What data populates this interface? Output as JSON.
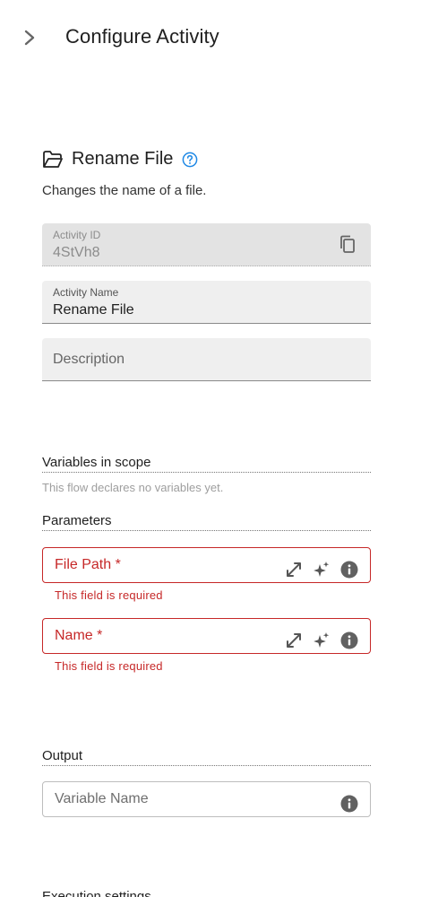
{
  "header": {
    "title": "Configure Activity",
    "toggle_icon": "chevron-right-icon"
  },
  "activity": {
    "icon": "folder-open-icon",
    "title": "Rename File",
    "help_icon": "help-circle-icon",
    "description": "Changes the name of a file."
  },
  "fields": {
    "activity_id": {
      "label": "Activity ID",
      "value": "4StVh8",
      "copy_icon": "copy-icon"
    },
    "activity_name": {
      "label": "Activity Name",
      "value": "Rename File"
    },
    "description": {
      "placeholder": "Description"
    }
  },
  "variables": {
    "title": "Variables in scope",
    "empty_text": "This flow declares no variables yet."
  },
  "parameters": {
    "title": "Parameters",
    "items": [
      {
        "label": "File Path *",
        "error": "This field is required",
        "icons": [
          "expand-icon",
          "sparkle-icon",
          "info-icon"
        ]
      },
      {
        "label": "Name *",
        "error": "This field is required",
        "icons": [
          "expand-icon",
          "sparkle-icon",
          "info-icon"
        ]
      }
    ]
  },
  "output": {
    "title": "Output",
    "field_label": "Variable Name",
    "info_icon": "info-icon"
  },
  "execution": {
    "title": "Execution settings"
  },
  "colors": {
    "error": "#c62828",
    "accent": "#1e88e5",
    "field_bg": "#efefef"
  }
}
